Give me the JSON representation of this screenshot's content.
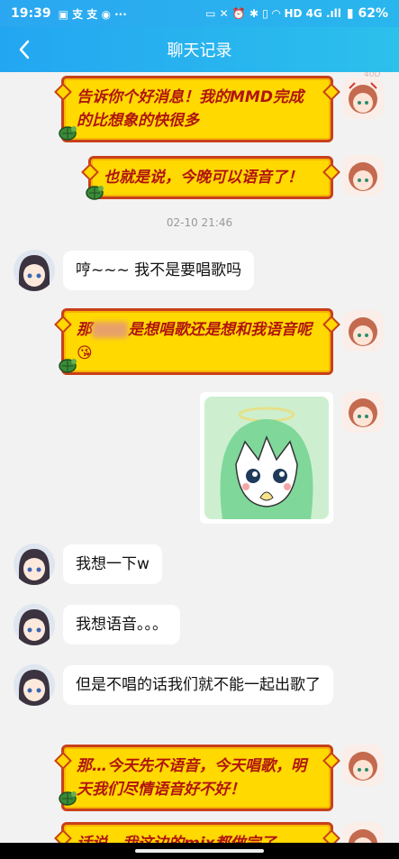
{
  "status_bar": {
    "time": "19:39",
    "left_glyphs": "▣ 支 支 ◉ ···",
    "right_glyphs": "▭ ✕ ⏰ ✱ ▯ ◠ HD 4G .ıll",
    "battery": "▮ 62%"
  },
  "header": {
    "title": "聊天记录"
  },
  "messages": [
    {
      "side": "right",
      "type": "fancy",
      "text": "告诉你个好消息！我的MMD完成的比想象的快很多"
    },
    {
      "side": "right",
      "type": "fancy",
      "text": "也就是说，今晚可以语音了！"
    },
    {
      "type": "timestamp",
      "text": "02-10 21:46"
    },
    {
      "side": "left",
      "type": "plain",
      "text": "哼~~~ 我不是要唱歌吗"
    },
    {
      "side": "right",
      "type": "fancy",
      "text_a": "那",
      "text_b": "是想唱歌还是想和我语音呢",
      "emoji": "😘"
    },
    {
      "side": "right",
      "type": "sticker"
    },
    {
      "side": "left",
      "type": "plain",
      "text": "我想一下w"
    },
    {
      "side": "left",
      "type": "plain",
      "text": "我想语音。。。"
    },
    {
      "side": "left",
      "type": "plain",
      "text": "但是不唱的话我们就不能一起出歌了"
    },
    {
      "side": "right",
      "type": "fancy",
      "text": "那…今天先不语音，今天唱歌，明天我们尽情语音好不好！"
    },
    {
      "side": "right",
      "type": "fancy",
      "text": "话说，我这边的mix都做完了"
    }
  ],
  "colors": {
    "accent": "#23a6f1",
    "fancy_bg": "#ffd900",
    "fancy_text": "#b0150f",
    "fancy_border": "#c8401b"
  },
  "pin_label": "40D"
}
